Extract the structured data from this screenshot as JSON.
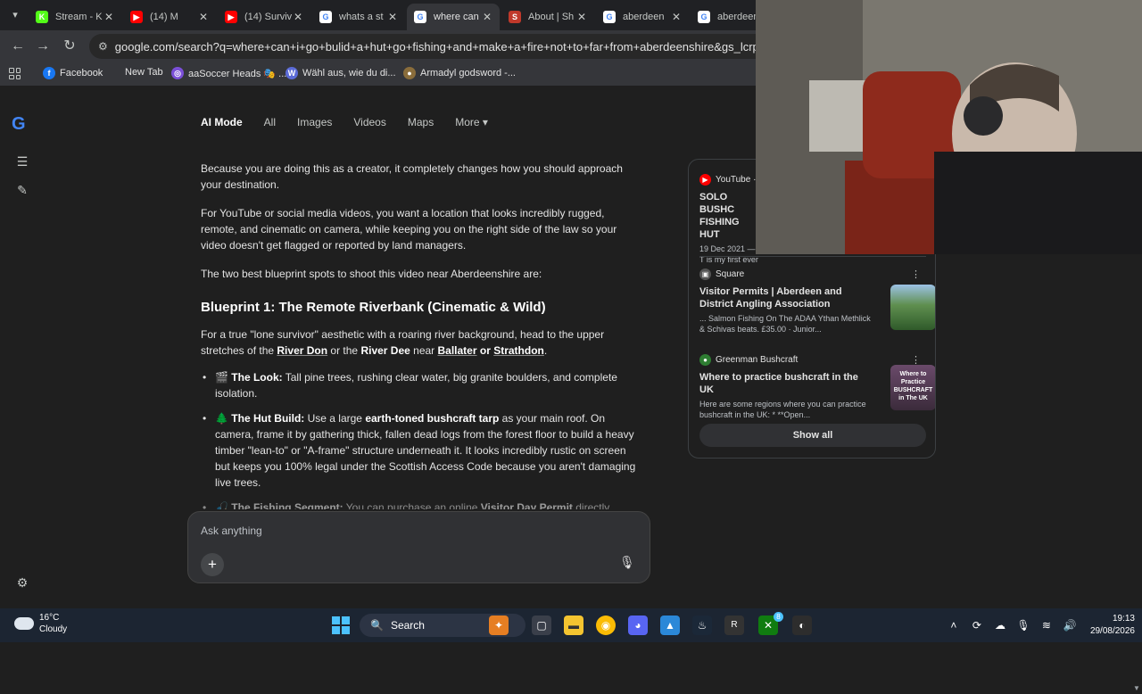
{
  "browser": {
    "tabs": [
      {
        "label": "Stream - K",
        "icon": "kick-icon",
        "color": "#53fc18",
        "glyph": "K"
      },
      {
        "label": "(14) M",
        "icon": "youtube-icon",
        "color": "#ff0000",
        "glyph": "▶"
      },
      {
        "label": "(14) Surviv",
        "icon": "youtube-icon",
        "color": "#ff0000",
        "glyph": "▶"
      },
      {
        "label": "whats a st",
        "icon": "google-icon",
        "color": "#ffffff",
        "glyph": "G"
      },
      {
        "label": "where can",
        "icon": "google-icon",
        "color": "#ffffff",
        "glyph": "G",
        "active": true
      },
      {
        "label": "About | Sh",
        "icon": "site-icon",
        "color": "#c0392b",
        "glyph": "S"
      },
      {
        "label": "aberdeen",
        "icon": "google-icon",
        "color": "#ffffff",
        "glyph": "G"
      },
      {
        "label": "aberdeen",
        "icon": "google-icon",
        "color": "#ffffff",
        "glyph": "G"
      }
    ],
    "url": "google.com/search?q=where+can+i+go+bulid+a+hut+go+fishing+and+make+a+fire+not+to+far+from+aberdeenshire&gs_lcrp=EgZjaH",
    "bookmarks": [
      {
        "label": "Facebook",
        "icon": "facebook-icon",
        "color": "#1877f2",
        "glyph": "f"
      },
      {
        "label": "New Tab",
        "icon": "",
        "color": "",
        "glyph": ""
      },
      {
        "label": "aaSoccer Heads 🎭 ...",
        "icon": "soccer-icon",
        "color": "#7b4fd8",
        "glyph": "◎"
      },
      {
        "label": "Wähl aus, wie du di...",
        "icon": "bookmark-icon",
        "color": "#5b6bd8",
        "glyph": "W"
      },
      {
        "label": "Armadyl godsword -...",
        "icon": "runescape-icon",
        "color": "#8a6d3b",
        "glyph": "●"
      }
    ]
  },
  "search": {
    "nav_tabs": [
      "AI Mode",
      "All",
      "Images",
      "Videos",
      "Maps",
      "More ▾"
    ],
    "ask_placeholder": "Ask anything"
  },
  "article": {
    "p1": "Because you are doing this as a creator, it completely changes how you should approach your destination.",
    "p2": "For YouTube or social media videos, you want a location that looks incredibly rugged, remote, and cinematic on camera, while keeping you on the right side of the law so your video doesn't get flagged or reported by land managers.",
    "p3": "The two best blueprint spots to shoot this video near Aberdeenshire are:",
    "h_blueprint1": "Blueprint 1: The Remote Riverbank (Cinematic & Wild)",
    "p4_a": "For a true \"lone survivor\" aesthetic with a roaring river background, head to the upper stretches of the ",
    "p4_don": "River Don",
    "p4_or": " or the ",
    "p4_dee": "River Dee",
    "p4_near": " near ",
    "p4_ballater": "Ballater",
    "p4_or2": " or ",
    "p4_strathdon": "Strathdon",
    "p4_end": ".",
    "b1_emoji": "🎬",
    "b1_title": "The Look:",
    "b1_text": " Tall pine trees, rushing clear water, big granite boulders, and complete isolation.",
    "b2_emoji": "🌲",
    "b2_title": "The Hut Build:",
    "b2_text1": " Use a large ",
    "b2_bold": "earth-toned bushcraft tarp",
    "b2_text2": " as your main roof. On camera, frame it by gathering thick, fallen dead logs from the forest floor to build a heavy timber \"lean-to\" or \"A-frame\" structure underneath it. It looks incredibly rustic on screen but keeps you 100% legal under the Scottish Access Code because you aren't damaging live trees.",
    "b3_emoji": "🎣",
    "b3_title": "The Fishing Segment:",
    "b3_text1": " You can purchase an online ",
    "b3_bold": "Visitor Day Permit",
    "b3_text2": " directly"
  },
  "sources": {
    "yt_site": "YouTube ·",
    "yt_title": "SOLO BUSHC FISHING HUT",
    "yt_snip": "19 Dec 2021 — T is my first ever",
    "s1_site": "Square",
    "s1_title": "Visitor Permits | Aberdeen and District Angling Association",
    "s1_snip": "... Salmon Fishing On The ADAA Ythan Methlick & Schivas beats. £35.00 · Junior...",
    "s2_site": "Greenman Bushcraft",
    "s2_title": "Where to practice bushcraft in the UK",
    "s2_snip": "Here are some regions where you can practice bushcraft in the UK: * **Open...",
    "thumb2_text": "Where to Practice BUSHCRAFT in The UK",
    "show_all": "Show all"
  },
  "taskbar": {
    "temp": "16°C",
    "weather": "Cloudy",
    "search": "Search",
    "time": "19:13",
    "date": "29/08/2026",
    "badge": "8"
  }
}
